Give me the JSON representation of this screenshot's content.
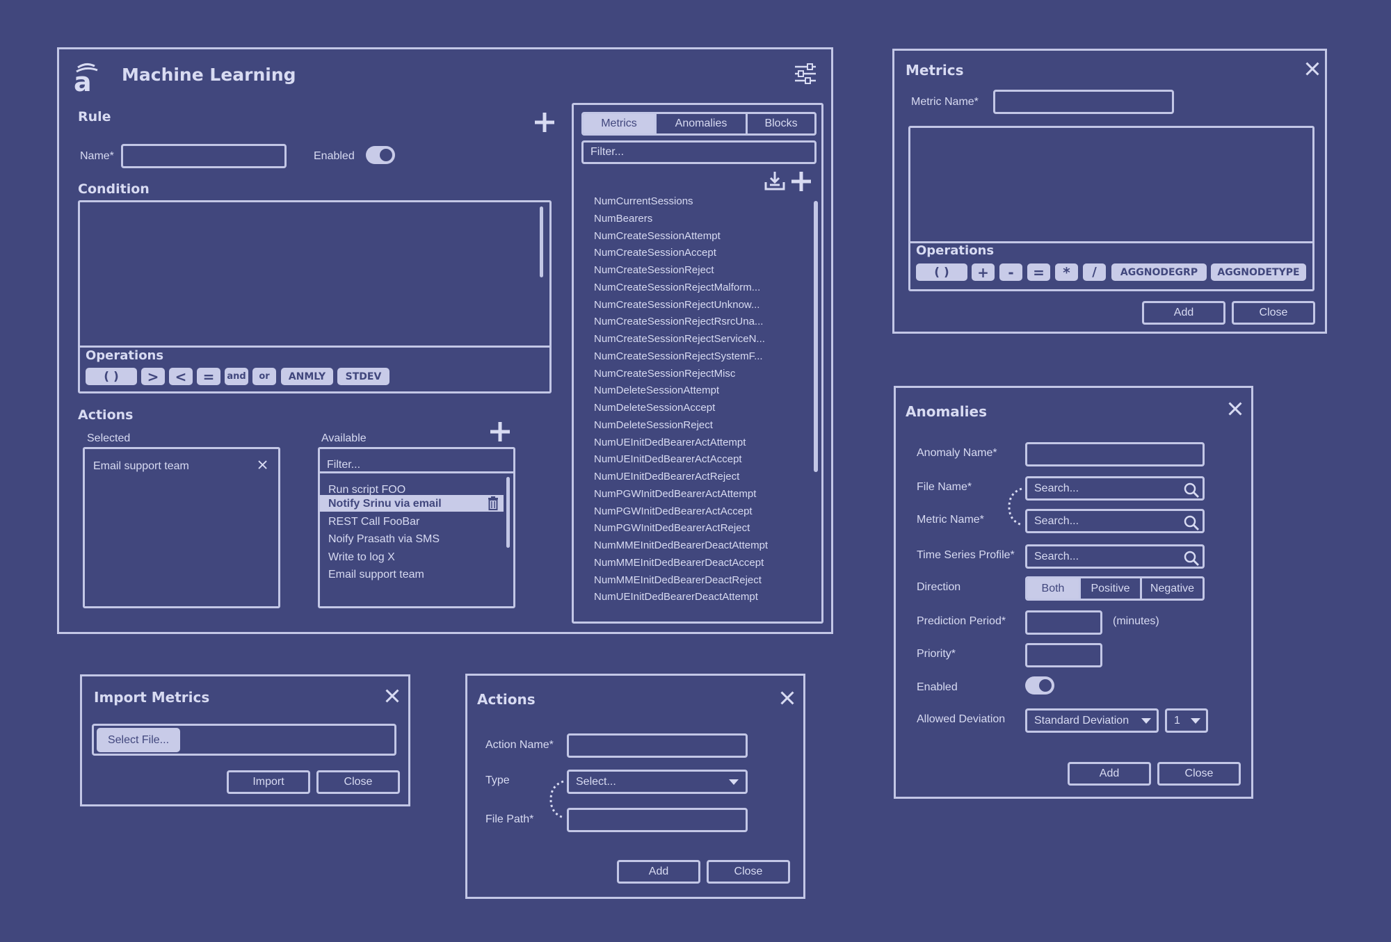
{
  "ml": {
    "title": "Machine Learning",
    "rule_heading": "Rule",
    "name_label": "Name*",
    "enabled_label": "Enabled",
    "condition_heading": "Condition",
    "operations_heading": "Operations",
    "ops": [
      "(      )",
      ">",
      "<",
      "=",
      "and",
      "or",
      "ANMLY",
      "STDEV"
    ],
    "actions_heading": "Actions",
    "selected_label": "Selected",
    "available_label": "Available",
    "selected_items": [
      "Email support team"
    ],
    "filter_placeholder": "Filter...",
    "available_items": [
      "Run script FOO",
      "Notify Srinu via email",
      "REST Call FooBar",
      "Noify Prasath via SMS",
      "Write to log X",
      "Email support team"
    ],
    "tabs": [
      "Metrics",
      "Anomalies",
      "Blocks"
    ],
    "active_tab": "Metrics",
    "metric_filter_placeholder": "Filter...",
    "metric_list": [
      "NumCurrentSessions",
      "NumBearers",
      "NumCreateSessionAttempt",
      "NumCreateSessionAccept",
      "NumCreateSessionReject",
      "NumCreateSessionRejectMalform...",
      "NumCreateSessionRejectUnknow...",
      "NumCreateSessionRejectRsrcUna...",
      "NumCreateSessionRejectServiceN...",
      "NumCreateSessionRejectSystemF...",
      "NumCreateSessionRejectMisc",
      "NumDeleteSessionAttempt",
      "NumDeleteSessionAccept",
      "NumDeleteSessionReject",
      "NumUEInitDedBearerActAttempt",
      "NumUEInitDedBearerActAccept",
      "NumUEInitDedBearerActReject",
      "NumPGWInitDedBearerActAttempt",
      "NumPGWInitDedBearerActAccept",
      "NumPGWInitDedBearerActReject",
      "NumMMEInitDedBearerDeactAttempt",
      "NumMMEInitDedBearerDeactAccept",
      "NumMMEInitDedBearerDeactReject",
      "NumUEInitDedBearerDeactAttempt"
    ]
  },
  "metrics_dialog": {
    "title": "Metrics",
    "metric_name_label": "Metric Name*",
    "operations_heading": "Operations",
    "ops": [
      "(      )",
      "+",
      "-",
      "=",
      "*",
      "/",
      "AGGNODEGRP",
      "AGGNODETYPE"
    ],
    "add": "Add",
    "close": "Close"
  },
  "import_dialog": {
    "title": "Import Metrics",
    "select_file": "Select File...",
    "import": "Import",
    "close": "Close"
  },
  "actions_dialog": {
    "title": "Actions",
    "action_name_label": "Action Name*",
    "type_label": "Type",
    "type_value": "Select...",
    "file_path_label": "File Path*",
    "add": "Add",
    "close": "Close"
  },
  "anomalies_dialog": {
    "title": "Anomalies",
    "anomaly_name_label": "Anomaly Name*",
    "file_name_label": "File Name*",
    "metric_name_label": "Metric Name*",
    "tsp_label": "Time Series Profile*",
    "search_placeholder": "Search...",
    "direction_label": "Direction",
    "direction_options": [
      "Both",
      "Positive",
      "Negative"
    ],
    "direction_selected": "Both",
    "prediction_label": "Prediction Period*",
    "minutes": "(minutes)",
    "priority_label": "Priority*",
    "enabled_label": "Enabled",
    "deviation_label": "Allowed Deviation",
    "deviation_value": "Standard Deviation",
    "deviation_count": "1",
    "add": "Add",
    "close": "Close"
  },
  "icons": [
    "logo-icon",
    "settings-sliders-icon",
    "plus-icon",
    "close-icon",
    "trash-icon",
    "import-icon",
    "search-icon",
    "dropdown-caret-icon"
  ],
  "colors": {
    "background": "#41477d",
    "line": "#c3c7e6",
    "fill": "#c8cbe8"
  }
}
